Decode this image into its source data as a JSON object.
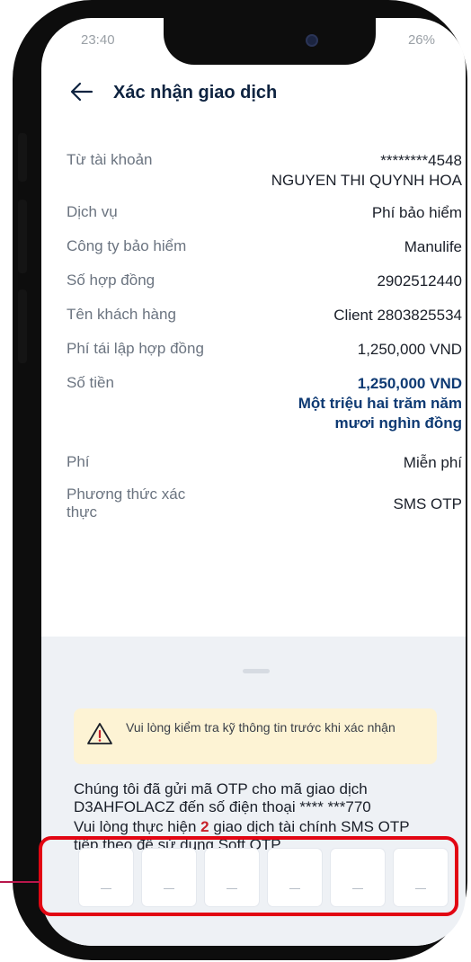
{
  "status": {
    "time": "23:40",
    "battery": "26%"
  },
  "header": {
    "title": "Xác nhận giao dịch"
  },
  "rows": [
    {
      "label": "Từ tài khoản",
      "value_line1": "********4548",
      "value_line2": "NGUYEN THI QUYNH HOA"
    },
    {
      "label": "Dịch vụ",
      "value": "Phí bảo hiểm"
    },
    {
      "label": "Công ty bảo hiểm",
      "value": "Manulife"
    },
    {
      "label": "Số hợp đồng",
      "value": "2902512440"
    },
    {
      "label": "Tên khách hàng",
      "value": "Client 2803825534"
    },
    {
      "label": "Phí tái lập hợp đồng",
      "value": "1,250,000 VND"
    },
    {
      "label": "Số tiền",
      "value": "1,250,000 VND",
      "words_line1": "Một triệu hai trăm năm",
      "words_line2": "mươi nghìn đồng"
    },
    {
      "label": "Phí",
      "value": "Miễn phí"
    },
    {
      "label_line1": "Phương thức xác",
      "label_line2": "thực",
      "value": "SMS OTP"
    }
  ],
  "warning": {
    "text": "Vui lòng kiểm tra kỹ thông tin trước khi xác nhận"
  },
  "otp_info": {
    "line1": "Chúng tôi đã gửi mã OTP cho mã giao dịch",
    "line2": "D3AHFOLACZ đến số điện thoại **** ***770",
    "line3_pre": "Vui lòng thực hiện ",
    "line3_count": "2",
    "line3_post": " giao dịch tài chính SMS OTP",
    "line4": "tiếp theo để sử dụng Soft OTP"
  },
  "otp_digits": [
    "",
    "",
    "",
    "",
    "",
    ""
  ],
  "colors": {
    "highlight": "#e20613",
    "amount": "#0e3a73",
    "title": "#0e2340"
  }
}
